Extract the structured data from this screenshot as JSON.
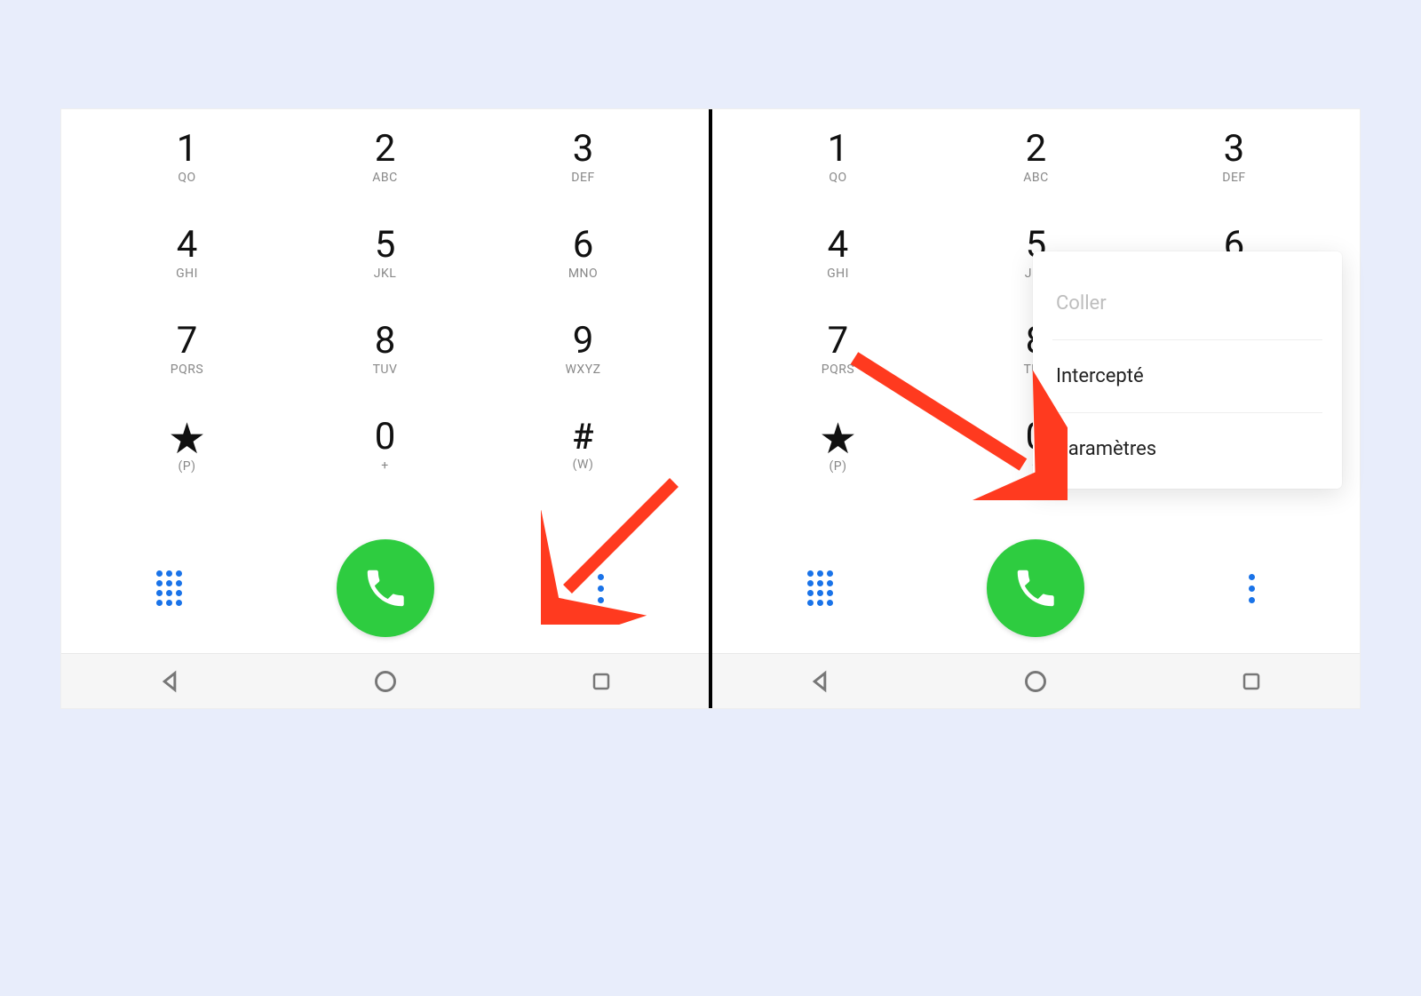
{
  "keys": [
    {
      "digit": "1",
      "sub": "QO"
    },
    {
      "digit": "2",
      "sub": "ABC"
    },
    {
      "digit": "3",
      "sub": "DEF"
    },
    {
      "digit": "4",
      "sub": "GHI"
    },
    {
      "digit": "5",
      "sub": "JKL"
    },
    {
      "digit": "6",
      "sub": "MNO"
    },
    {
      "digit": "7",
      "sub": "PQRS"
    },
    {
      "digit": "8",
      "sub": "TUV"
    },
    {
      "digit": "9",
      "sub": "WXYZ"
    },
    {
      "digit": "★",
      "sub": "(P)",
      "star": true
    },
    {
      "digit": "0",
      "sub": "+"
    },
    {
      "digit": "#",
      "sub": "(W)",
      "hash": true
    }
  ],
  "menu": {
    "item1": "Coller",
    "item2": "Intercepté",
    "item3": "Paramètres"
  },
  "colors": {
    "accent_blue": "#1a73e8",
    "call_green": "#2ecc40",
    "arrow_red": "#ff3a1f"
  }
}
